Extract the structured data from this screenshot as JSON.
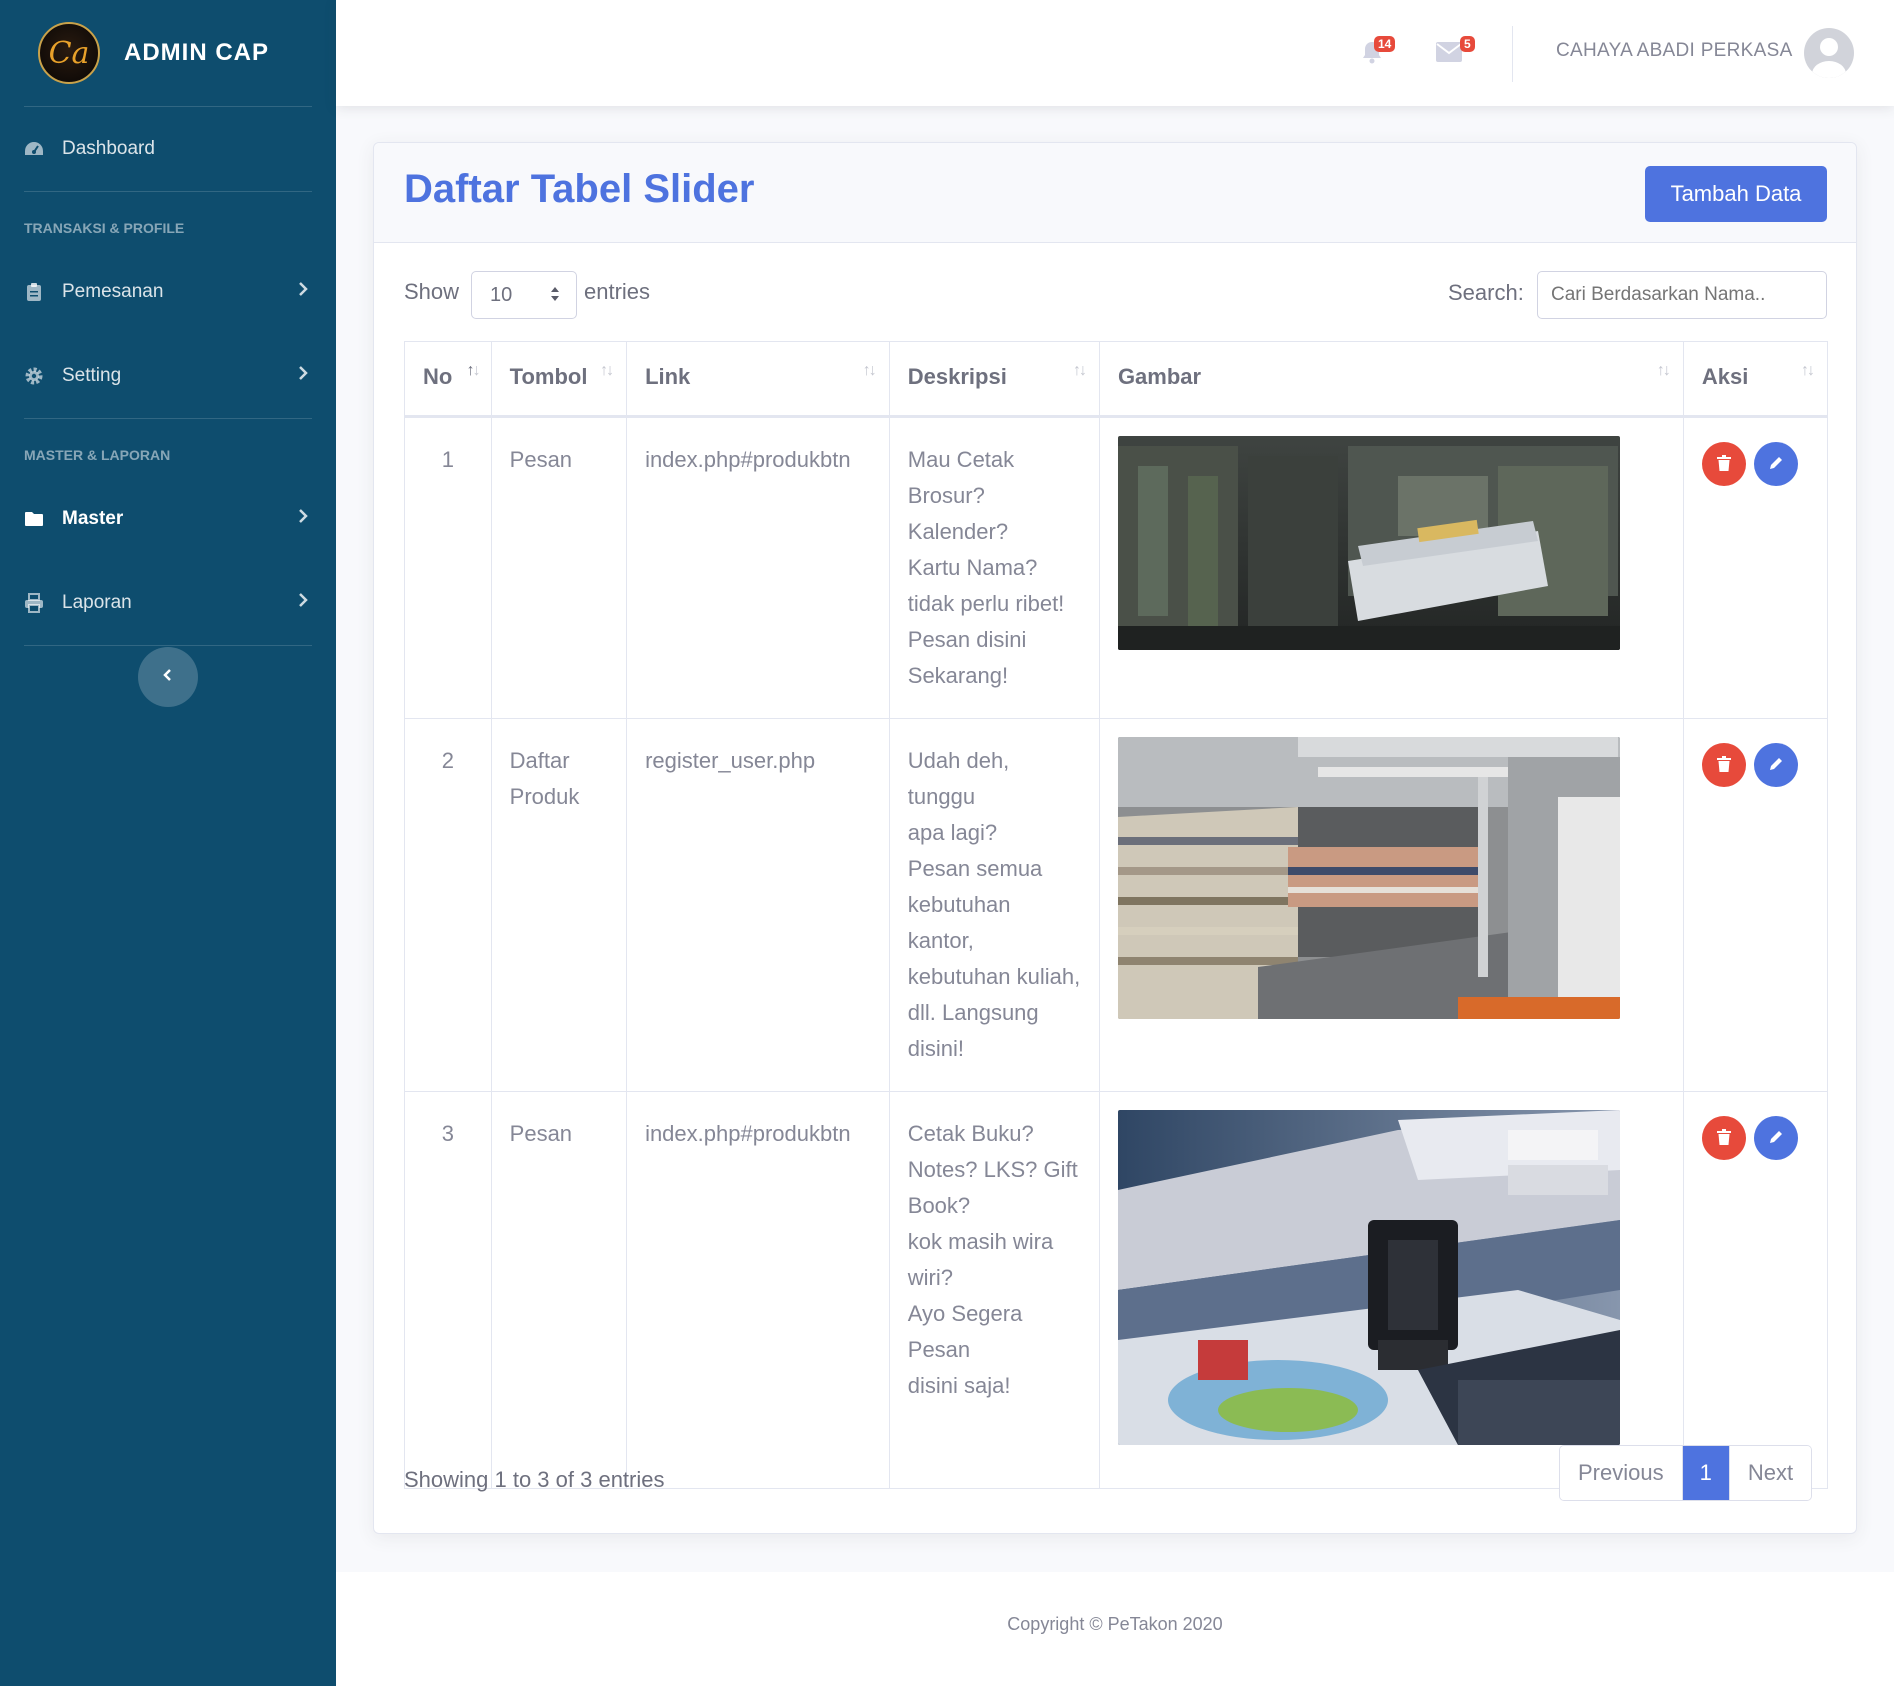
{
  "brand": {
    "title": "ADMIN CAP",
    "logo_text": "Ca"
  },
  "sidebar": {
    "dashboard": "Dashboard",
    "heading_1": "TRANSAKSI & PROFILE",
    "pemesanan": "Pemesanan",
    "setting": "Setting",
    "heading_2": "MASTER & LAPORAN",
    "master": "Master",
    "laporan": "Laporan"
  },
  "topbar": {
    "alerts_count": "14",
    "messages_count": "5",
    "user_name": "CAHAYA ABADI PERKASA"
  },
  "page": {
    "title": "Daftar Tabel Slider",
    "add_button": "Tambah Data"
  },
  "table_controls": {
    "show_label": "Show",
    "entries_value": "10",
    "entries_label": "entries",
    "search_label": "Search:",
    "search_placeholder": "Cari Berdasarkan Nama.."
  },
  "table": {
    "columns": [
      "No",
      "Tombol",
      "Link",
      "Deskripsi",
      "Gambar",
      "Aksi"
    ],
    "rows": [
      {
        "no": "1",
        "tombol": "Pesan",
        "link": "index.php#produkbtn",
        "deskripsi": [
          "Mau Cetak",
          "Brosur? Kalender?",
          "Kartu Nama?",
          "tidak perlu ribet!",
          "Pesan disini",
          "Sekarang!"
        ]
      },
      {
        "no": "2",
        "tombol": "Daftar Produk",
        "link": "register_user.php",
        "deskripsi": [
          "Udah deh, tunggu",
          "apa lagi?",
          "Pesan semua",
          "kebutuhan kantor,",
          "kebutuhan kuliah,",
          "dll. Langsung",
          "disini!"
        ]
      },
      {
        "no": "3",
        "tombol": "Pesan",
        "link": "index.php#produkbtn",
        "deskripsi": [
          "Cetak Buku?",
          "Notes? LKS? Gift",
          "Book?",
          "kok masih wira",
          "wiri?",
          "Ayo Segera Pesan",
          "disini saja!"
        ]
      }
    ]
  },
  "pagination": {
    "info": "Showing 1 to 3 of 3 entries",
    "previous": "Previous",
    "current": "1",
    "next": "Next"
  },
  "footer": {
    "copyright": "Copyright © PeTakon 2020"
  },
  "colors": {
    "sidebar": "#0e4d6e",
    "primary": "#4e73df",
    "danger": "#e74a3b"
  }
}
